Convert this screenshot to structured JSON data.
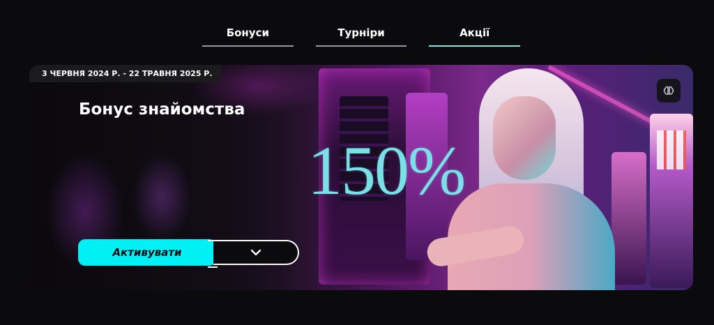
{
  "tabs": [
    {
      "label": "Бонуси",
      "active": false
    },
    {
      "label": "Турніри",
      "active": false
    },
    {
      "label": "Акції",
      "active": true
    }
  ],
  "promo": {
    "date_range": "3 ЧЕРВНЯ 2024 Р. - 22 ТРАВНЯ 2025 Р.",
    "title": "Бонус знайомства",
    "headline_value": "150%",
    "activate_label": "Активувати",
    "expand_icon": "chevron-down-icon",
    "corner_icon": "brain-icon"
  },
  "colors": {
    "accent": "#00f0f5",
    "active_tab_underline": "#7fe7f0",
    "background": "#0b0a0c"
  }
}
